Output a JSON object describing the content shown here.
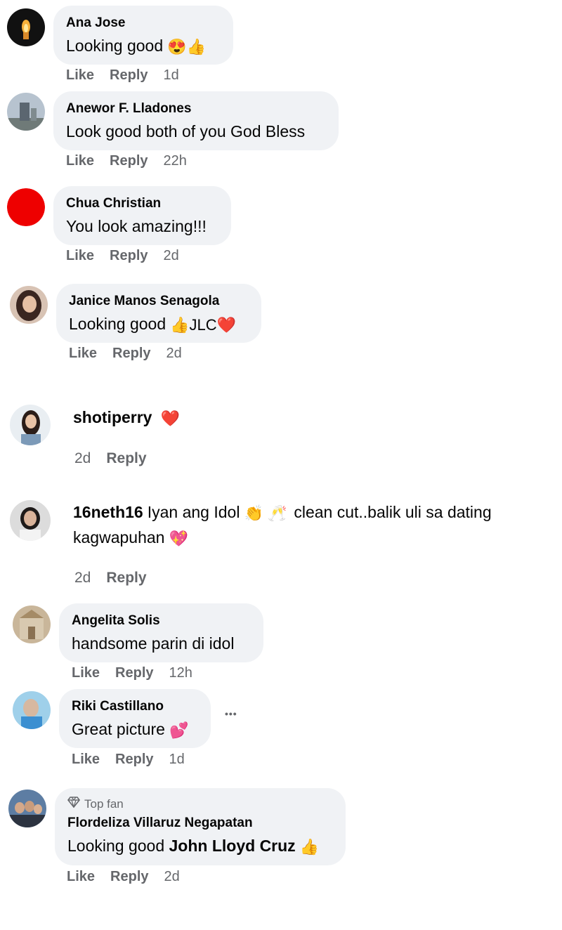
{
  "comments": [
    {
      "name": "Ana Jose",
      "text": "Looking good",
      "emoji": "😍👍",
      "like": "Like",
      "reply": "Reply",
      "time": "1d"
    },
    {
      "name": "Anewor F. Lladones",
      "text": "Look good both of you God Bless",
      "like": "Like",
      "reply": "Reply",
      "time": "22h"
    },
    {
      "name": "Chua Christian",
      "text": "You look amazing!!!",
      "like": "Like",
      "reply": "Reply",
      "time": "2d"
    },
    {
      "name": "Janice Manos Senagola",
      "text": "Looking good",
      "emoji": "👍JLC❤️",
      "like": "Like",
      "reply": "Reply",
      "time": "2d"
    },
    {
      "name": "shotiperry",
      "emoji": "❤️",
      "reply": "Reply",
      "time": "2d"
    },
    {
      "name": "16neth16",
      "text_line1": "Iyan ang Idol",
      "emoji1": "👏 🥂",
      "text_line1b": "clean cut..balik uli sa dating",
      "text_line2": "kagwapuhan",
      "emoji2": "💖",
      "reply": "Reply",
      "time": "2d"
    },
    {
      "name": "Angelita Solis",
      "text": "handsome parin di idol",
      "like": "Like",
      "reply": "Reply",
      "time": "12h"
    },
    {
      "name": "Riki Castillano",
      "text": "Great picture",
      "emoji": "💕",
      "more": "•••",
      "like": "Like",
      "reply": "Reply",
      "time": "1d"
    },
    {
      "badge": "Top fan",
      "name": "Flordeliza Villaruz Negapatan",
      "text": "Looking good",
      "mention": "John Lloyd Cruz",
      "emoji": "👍",
      "like": "Like",
      "reply": "Reply",
      "time": "2d"
    }
  ],
  "colors": {
    "bubble": "#f0f2f5",
    "meta": "#65676b",
    "text": "#050505"
  }
}
